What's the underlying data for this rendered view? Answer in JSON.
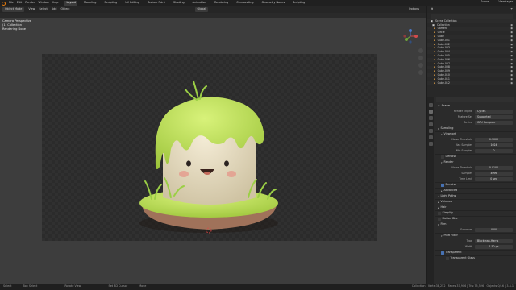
{
  "topbar": {
    "menus": [
      "File",
      "Edit",
      "Render",
      "Window",
      "Help"
    ],
    "workspaces": [
      "Layout",
      "Modeling",
      "Sculpting",
      "UV Editing",
      "Texture Paint",
      "Shading",
      "Animation",
      "Rendering",
      "Compositing",
      "Geometry Nodes",
      "Scripting"
    ],
    "active_workspace": "Layout",
    "scene": "Scene",
    "view_layer": "ViewLayer"
  },
  "viewport": {
    "mode": "Object Mode",
    "menus": [
      "View",
      "Select",
      "Add",
      "Object"
    ],
    "transform": "Global",
    "options": "Options",
    "overlay_lines": [
      "Camera Perspective",
      "(1) Collection",
      "Rendering Done"
    ]
  },
  "outliner": {
    "root": "Scene Collection",
    "collection": "Collection",
    "items": [
      "Camera",
      "Circle",
      "Cube",
      "Cube.001",
      "Cube.002",
      "Cube.003",
      "Cube.004",
      "Cube.005",
      "Cube.006",
      "Cube.007",
      "Cube.008",
      "Cube.009",
      "Cube.010",
      "Cube.011",
      "Cube.012"
    ]
  },
  "properties": {
    "title": "Scene",
    "render_engine": {
      "label": "Render Engine",
      "value": "Cycles"
    },
    "feature_set": {
      "label": "Feature Set",
      "value": "Supported"
    },
    "device": {
      "label": "Device",
      "value": "GPU Compute"
    },
    "sampling": "Sampling",
    "viewport_sec": "Viewport",
    "noise_threshold": {
      "label": "Noise Threshold",
      "value": "0.1000"
    },
    "max_samples_vp": {
      "label": "Max Samples",
      "value": "1024"
    },
    "min_samples_vp": {
      "label": "Min Samples",
      "value": "0"
    },
    "denoise": "Denoise",
    "render_sec": "Render",
    "noise_threshold_r": {
      "label": "Noise Threshold",
      "value": "0.0100"
    },
    "samples_r": {
      "label": "Samples",
      "value": "4096"
    },
    "time_limit": {
      "label": "Time Limit",
      "value": "0 sec"
    },
    "denoise_r": "Denoise",
    "advanced": "Advanced",
    "sections": [
      "Light Paths",
      "Volumes",
      "Hair",
      "Simplify",
      "Motion Blur",
      "Film"
    ],
    "exposure": {
      "label": "Exposure",
      "value": "0.00"
    },
    "pixel_filter": "Pixel Filter",
    "filter_type": {
      "label": "Type",
      "value": "Blackman-Harris"
    },
    "filter_width": {
      "label": "Width",
      "value": "1.50 px"
    },
    "transparent": "Transparent",
    "transparent_glass": "Transparent Glass"
  },
  "statusbar": {
    "items": [
      "Select",
      "Box Select",
      "Rotate View",
      "Set 3D Cursor",
      "Move"
    ],
    "version": "Collection | Verts:38,252 | Faces:37,906 | Tris:75,526 | Objects:0/16 | 3.4.1"
  },
  "colors": {
    "accent": "#e87d0d",
    "selection": "#4772b3",
    "bg": "#1d1d1d",
    "viewport": "#3d3d3d"
  }
}
